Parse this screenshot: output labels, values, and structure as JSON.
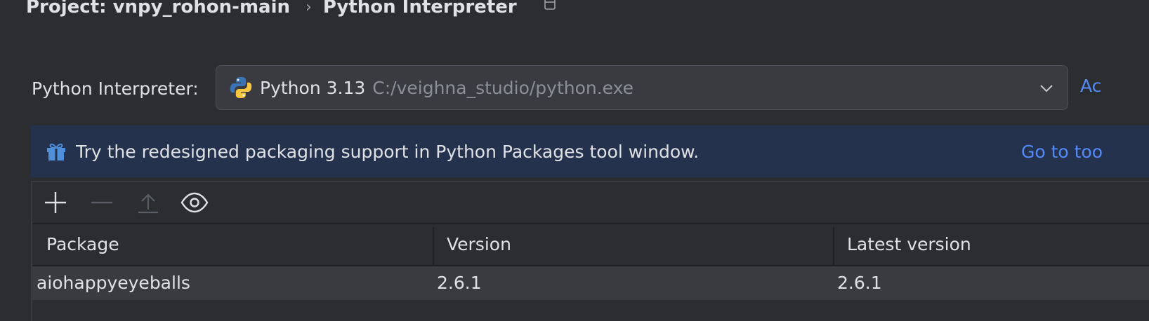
{
  "breadcrumb": {
    "project": "Project: vnpy_rohon-main",
    "separator": "›",
    "page": "Python Interpreter"
  },
  "interpreter": {
    "label": "Python Interpreter:",
    "name": "Python 3.13",
    "path": "C:/veighna_studio/python.exe",
    "add_link": "Ac"
  },
  "banner": {
    "text": "Try the redesigned packaging support in Python Packages tool window.",
    "link": "Go to too"
  },
  "table": {
    "columns": [
      "Package",
      "Version",
      "Latest version"
    ],
    "rows": [
      {
        "package": "aiohappyeyeballs",
        "version": "2.6.1",
        "latest": "2.6.1"
      }
    ]
  },
  "colors": {
    "accent_link": "#548af7",
    "background": "#2b2d30",
    "banner": "#25324d"
  }
}
